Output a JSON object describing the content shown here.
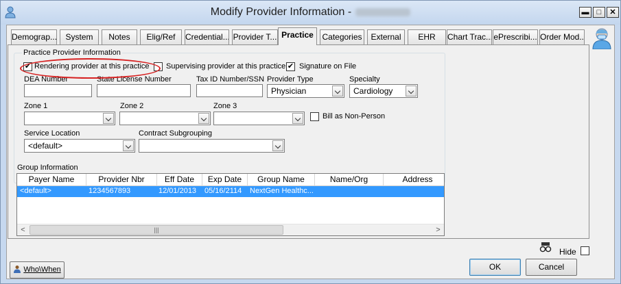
{
  "window": {
    "title": "Modify Provider Information -",
    "controls": {
      "minimize": "▬",
      "maximize": "□",
      "close": "✕"
    }
  },
  "tabs": [
    {
      "label": "Demograp..."
    },
    {
      "label": "System"
    },
    {
      "label": "Notes"
    },
    {
      "label": "Elig/Ref"
    },
    {
      "label": "Credential..."
    },
    {
      "label": "Provider T..."
    },
    {
      "label": "Practice",
      "active": true
    },
    {
      "label": "Categories"
    },
    {
      "label": "External"
    },
    {
      "label": "EHR"
    },
    {
      "label": "Chart Trac..."
    },
    {
      "label": "ePrescribi..."
    },
    {
      "label": "Order Mod..."
    }
  ],
  "practice": {
    "group_title": "Practice Provider Information",
    "rendering_label": "Rendering provider at this practice",
    "rendering_checked": true,
    "supervising_label": "Supervising provider at this practice",
    "supervising_checked": false,
    "signature_label": "Signature on File",
    "signature_checked": true,
    "dea_label": "DEA Number",
    "dea_value": "",
    "state_license_label": "State License Number",
    "state_license_value": "",
    "tax_id_label": "Tax ID Number/SSN",
    "tax_id_value": "",
    "provider_type_label": "Provider Type",
    "provider_type_value": "Physician",
    "specialty_label": "Specialty",
    "specialty_value": "Cardiology",
    "zone1_label": "Zone 1",
    "zone1_value": "",
    "zone2_label": "Zone 2",
    "zone2_value": "",
    "zone3_label": "Zone 3",
    "zone3_value": "",
    "bill_non_person_label": "Bill as Non-Person",
    "bill_non_person_checked": false,
    "service_location_label": "Service Location",
    "service_location_value": "<default>",
    "contract_label": "Contract Subgrouping",
    "contract_value": ""
  },
  "group": {
    "title": "Group Information",
    "columns": [
      "Payer Name",
      "Provider Nbr",
      "Eff Date",
      "Exp Date",
      "Group Name",
      "Name/Org",
      "Address"
    ],
    "rows": [
      {
        "payer": "<default>",
        "provider_nbr": "1234567893",
        "eff_date": "12/01/2013",
        "exp_date": "05/16/2114",
        "group_name": "NextGen Healthc...",
        "name_org": "",
        "address": ""
      }
    ],
    "scroll_thumb": "|||"
  },
  "footer": {
    "who_when_label": "Who\\When",
    "hide_label": "Hide",
    "hide_checked": false,
    "ok_label": "OK",
    "cancel_label": "Cancel"
  }
}
